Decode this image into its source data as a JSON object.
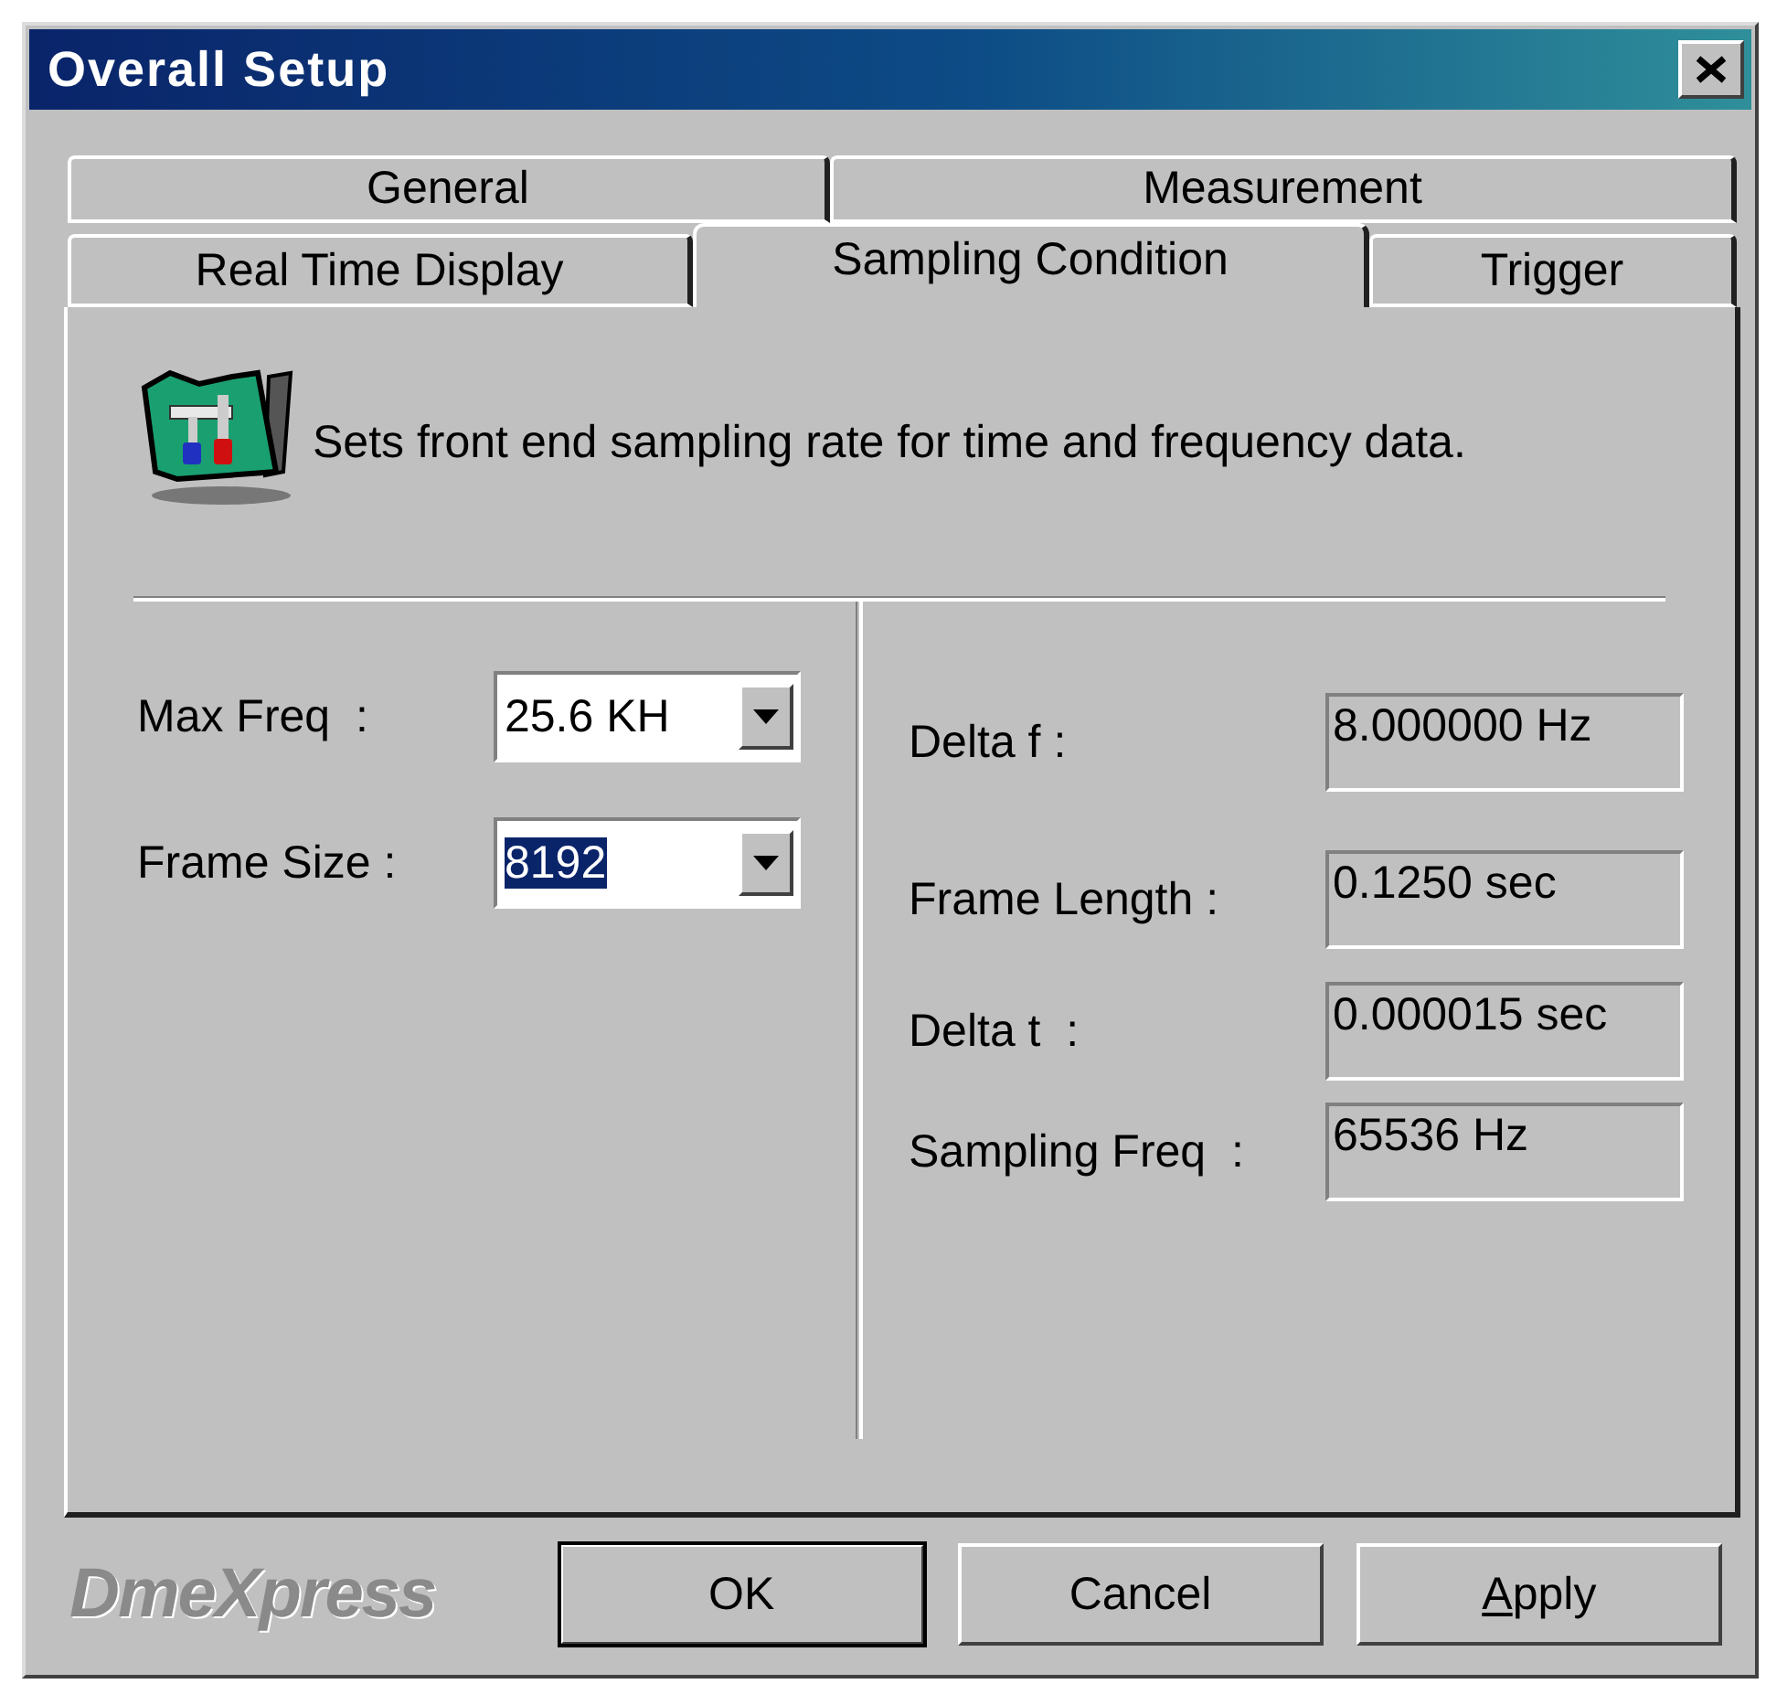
{
  "window": {
    "title": "Overall Setup"
  },
  "tab_rows": [
    {
      "tabs": [
        {
          "label": "General",
          "selected": false
        },
        {
          "label": "Measurement",
          "selected": false
        }
      ]
    },
    {
      "tabs": [
        {
          "label": "Real Time Display",
          "selected": false
        },
        {
          "label": "Sampling Condition",
          "selected": true
        },
        {
          "label": "Trigger",
          "selected": false
        }
      ]
    }
  ],
  "description": "Sets front end sampling rate for time and frequency data.",
  "settings": [
    {
      "label": "Max Freq  :",
      "value": "25.6 KH",
      "selected": false
    },
    {
      "label": "Frame Size :",
      "value": "8192",
      "selected": true
    }
  ],
  "readouts": [
    {
      "label": "Delta f :",
      "value": "8.000000 Hz"
    },
    {
      "label": "Frame Length :",
      "value": "0.1250 sec"
    },
    {
      "label": "Delta t  :",
      "value": "0.000015 sec"
    },
    {
      "label": "Sampling Freq  :",
      "value": "65536 Hz"
    }
  ],
  "logo": "DmeXpress",
  "buttons": [
    {
      "label": "OK",
      "default": true,
      "accelerator": false
    },
    {
      "label": "Cancel",
      "default": false,
      "accelerator": false
    },
    {
      "label": "Apply",
      "default": false,
      "accelerator": true
    }
  ]
}
